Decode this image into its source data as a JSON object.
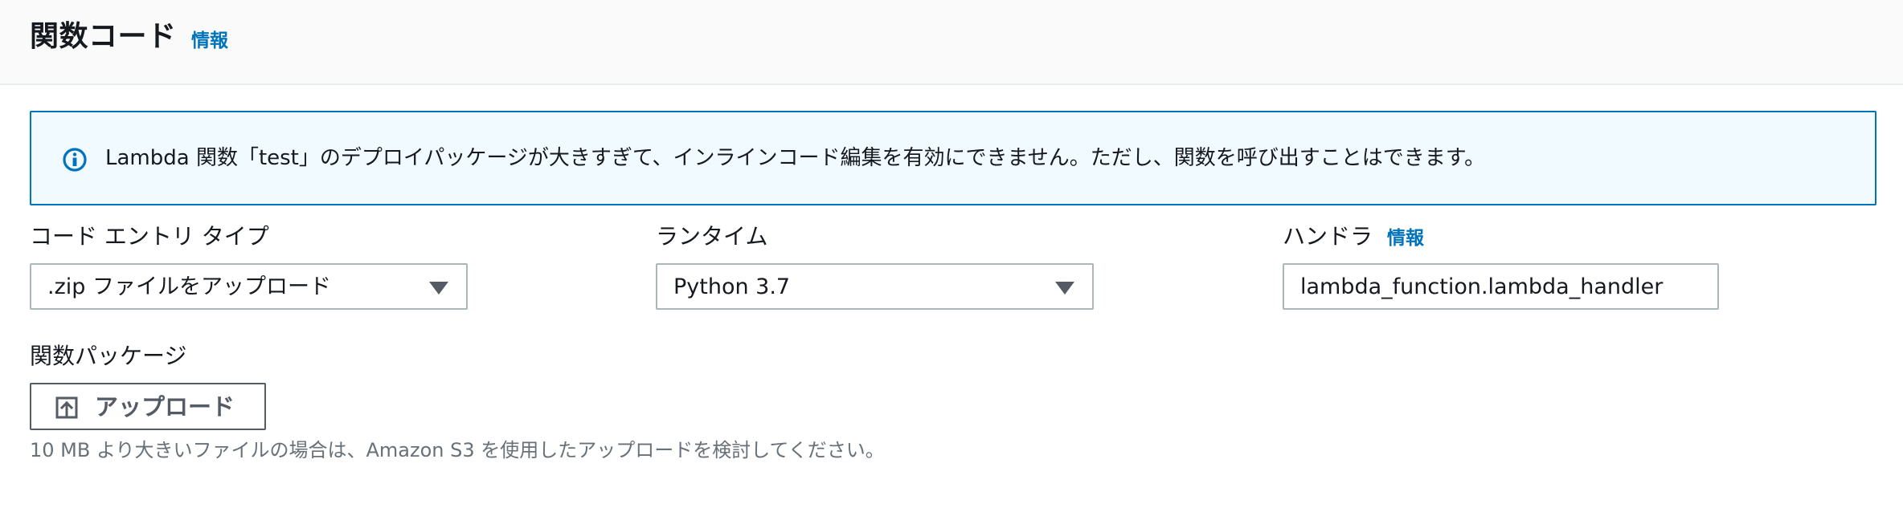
{
  "header": {
    "title": "関数コード",
    "info_link": "情報"
  },
  "alert": {
    "icon": "info-circle-icon",
    "message": "Lambda 関数「test」のデプロイパッケージが大きすぎて、インラインコード編集を有効にできません。ただし、関数を呼び出すことはできます。"
  },
  "code_entry_type": {
    "label": "コード エントリ タイプ",
    "selected": ".zip ファイルをアップロード"
  },
  "runtime": {
    "label": "ランタイム",
    "selected": "Python 3.7"
  },
  "handler": {
    "label": "ハンドラ",
    "info_link": "情報",
    "value": "lambda_function.lambda_handler"
  },
  "function_package": {
    "label": "関数パッケージ",
    "upload_button": "アップロード",
    "upload_icon": "upload-icon",
    "hint": "10 MB より大きいファイルの場合は、Amazon S3 を使用したアップロードを検討してください。"
  },
  "colors": {
    "accent": "#0073bb",
    "alert_background": "#f1faff",
    "border": "#aab7b8",
    "text": "#16191f",
    "muted_text": "#687078"
  }
}
